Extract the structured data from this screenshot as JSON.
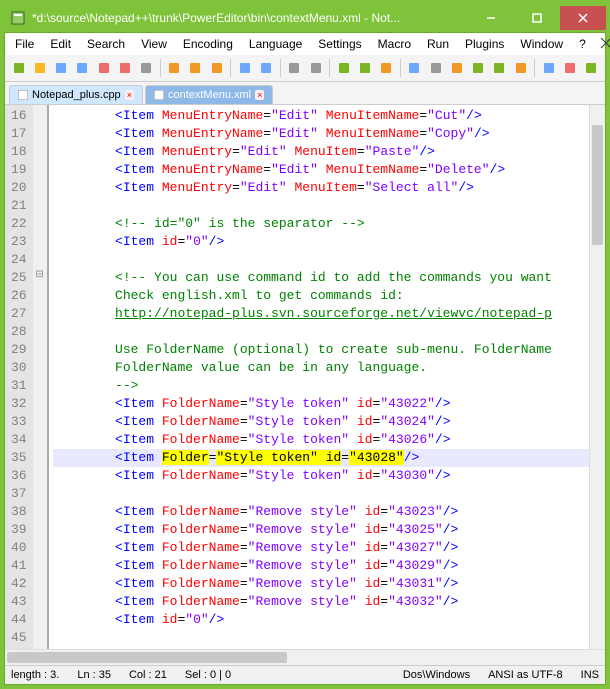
{
  "title": "*d:\\source\\Notepad++\\trunk\\PowerEditor\\bin\\contextMenu.xml - Not...",
  "menu": [
    "File",
    "Edit",
    "Search",
    "View",
    "Encoding",
    "Language",
    "Settings",
    "Macro",
    "Run",
    "Plugins",
    "Window",
    "?"
  ],
  "tabs": [
    {
      "label": "Notepad_plus.cpp",
      "active": false
    },
    {
      "label": "contextMenu.xml",
      "active": true
    }
  ],
  "lines": [
    {
      "n": 16,
      "tokens": [
        {
          "t": "<Item ",
          "c": "tag"
        },
        {
          "t": "MenuEntryName",
          "c": "attr"
        },
        {
          "t": "=",
          "c": "blk"
        },
        {
          "t": "\"Edit\"",
          "c": "str"
        },
        {
          "t": " MenuItemName",
          "c": "attr"
        },
        {
          "t": "=",
          "c": "blk"
        },
        {
          "t": "\"Cut\"",
          "c": "str"
        },
        {
          "t": "/>",
          "c": "tag"
        }
      ]
    },
    {
      "n": 17,
      "tokens": [
        {
          "t": "<Item ",
          "c": "tag"
        },
        {
          "t": "MenuEntryName",
          "c": "attr"
        },
        {
          "t": "=",
          "c": "blk"
        },
        {
          "t": "\"Edit\"",
          "c": "str"
        },
        {
          "t": " MenuItemName",
          "c": "attr"
        },
        {
          "t": "=",
          "c": "blk"
        },
        {
          "t": "\"Copy\"",
          "c": "str"
        },
        {
          "t": "/>",
          "c": "tag"
        }
      ]
    },
    {
      "n": 18,
      "tokens": [
        {
          "t": "<Item ",
          "c": "tag"
        },
        {
          "t": "MenuEntry",
          "c": "attr"
        },
        {
          "t": "=",
          "c": "blk"
        },
        {
          "t": "\"Edit\"",
          "c": "str"
        },
        {
          "t": " MenuItem",
          "c": "attr"
        },
        {
          "t": "=",
          "c": "blk"
        },
        {
          "t": "\"Paste\"",
          "c": "str"
        },
        {
          "t": "/>",
          "c": "tag"
        }
      ]
    },
    {
      "n": 19,
      "tokens": [
        {
          "t": "<Item ",
          "c": "tag"
        },
        {
          "t": "MenuEntryName",
          "c": "attr"
        },
        {
          "t": "=",
          "c": "blk"
        },
        {
          "t": "\"Edit\"",
          "c": "str"
        },
        {
          "t": " MenuItemName",
          "c": "attr"
        },
        {
          "t": "=",
          "c": "blk"
        },
        {
          "t": "\"Delete\"",
          "c": "str"
        },
        {
          "t": "/>",
          "c": "tag"
        }
      ]
    },
    {
      "n": 20,
      "tokens": [
        {
          "t": "<Item ",
          "c": "tag"
        },
        {
          "t": "MenuEntry",
          "c": "attr"
        },
        {
          "t": "=",
          "c": "blk"
        },
        {
          "t": "\"Edit\"",
          "c": "str"
        },
        {
          "t": " MenuItem",
          "c": "attr"
        },
        {
          "t": "=",
          "c": "blk"
        },
        {
          "t": "\"Select all\"",
          "c": "str"
        },
        {
          "t": "/>",
          "c": "tag"
        }
      ]
    },
    {
      "n": 21,
      "tokens": []
    },
    {
      "n": 22,
      "tokens": [
        {
          "t": "<!-- id=\"0\" is the separator -->",
          "c": "cmt"
        }
      ]
    },
    {
      "n": 23,
      "tokens": [
        {
          "t": "<Item ",
          "c": "tag"
        },
        {
          "t": "id",
          "c": "attr"
        },
        {
          "t": "=",
          "c": "blk"
        },
        {
          "t": "\"0\"",
          "c": "str"
        },
        {
          "t": "/>",
          "c": "tag"
        }
      ]
    },
    {
      "n": 24,
      "tokens": []
    },
    {
      "n": 25,
      "tokens": [
        {
          "t": "<!-- You can use command id to add the commands you want",
          "c": "cmt"
        }
      ],
      "fold": "-"
    },
    {
      "n": 26,
      "tokens": [
        {
          "t": "Check english.xml to get commands id:",
          "c": "cmt"
        }
      ]
    },
    {
      "n": 27,
      "tokens": [
        {
          "t": "http://notepad-plus.svn.sourceforge.net/viewvc/notepad-p",
          "c": "cmt underline"
        }
      ]
    },
    {
      "n": 28,
      "tokens": []
    },
    {
      "n": 29,
      "tokens": [
        {
          "t": "Use FolderName (optional) to create sub-menu. FolderName",
          "c": "cmt"
        }
      ]
    },
    {
      "n": 30,
      "tokens": [
        {
          "t": "FolderName value can be in any language.",
          "c": "cmt"
        }
      ]
    },
    {
      "n": 31,
      "tokens": [
        {
          "t": "-->",
          "c": "cmt"
        }
      ]
    },
    {
      "n": 32,
      "tokens": [
        {
          "t": "<Item ",
          "c": "tag"
        },
        {
          "t": "FolderName",
          "c": "attr"
        },
        {
          "t": "=",
          "c": "blk"
        },
        {
          "t": "\"Style token\"",
          "c": "str"
        },
        {
          "t": " id",
          "c": "attr"
        },
        {
          "t": "=",
          "c": "blk"
        },
        {
          "t": "\"43022\"",
          "c": "str"
        },
        {
          "t": "/>",
          "c": "tag"
        }
      ]
    },
    {
      "n": 33,
      "tokens": [
        {
          "t": "<Item ",
          "c": "tag"
        },
        {
          "t": "FolderName",
          "c": "attr"
        },
        {
          "t": "=",
          "c": "blk"
        },
        {
          "t": "\"Style token\"",
          "c": "str"
        },
        {
          "t": " id",
          "c": "attr"
        },
        {
          "t": "=",
          "c": "blk"
        },
        {
          "t": "\"43024\"",
          "c": "str"
        },
        {
          "t": "/>",
          "c": "tag"
        }
      ]
    },
    {
      "n": 34,
      "tokens": [
        {
          "t": "<Item ",
          "c": "tag"
        },
        {
          "t": "FolderName",
          "c": "attr"
        },
        {
          "t": "=",
          "c": "blk"
        },
        {
          "t": "\"Style token\"",
          "c": "str"
        },
        {
          "t": " id",
          "c": "attr"
        },
        {
          "t": "=",
          "c": "blk"
        },
        {
          "t": "\"43026\"",
          "c": "str"
        },
        {
          "t": "/>",
          "c": "tag"
        }
      ]
    },
    {
      "n": 35,
      "hl": true,
      "tokens": [
        {
          "t": "<Item ",
          "c": "tag"
        },
        {
          "t": "Folder",
          "c": "hly"
        },
        {
          "t": "=",
          "c": "blk"
        },
        {
          "t": "\"Style token\" ",
          "c": "hly"
        },
        {
          "t": "id",
          "c": "hly"
        },
        {
          "t": "=",
          "c": "blk"
        },
        {
          "t": "\"43028\"",
          "c": "hly"
        },
        {
          "t": "/>",
          "c": "tag"
        }
      ]
    },
    {
      "n": 36,
      "tokens": [
        {
          "t": "<Item ",
          "c": "tag"
        },
        {
          "t": "FolderName",
          "c": "attr"
        },
        {
          "t": "=",
          "c": "blk"
        },
        {
          "t": "\"Style token\"",
          "c": "str"
        },
        {
          "t": " id",
          "c": "attr"
        },
        {
          "t": "=",
          "c": "blk"
        },
        {
          "t": "\"43030\"",
          "c": "str"
        },
        {
          "t": "/>",
          "c": "tag"
        }
      ]
    },
    {
      "n": 37,
      "tokens": []
    },
    {
      "n": 38,
      "tokens": [
        {
          "t": "<Item ",
          "c": "tag"
        },
        {
          "t": "FolderName",
          "c": "attr"
        },
        {
          "t": "=",
          "c": "blk"
        },
        {
          "t": "\"Remove style\"",
          "c": "str"
        },
        {
          "t": " id",
          "c": "attr"
        },
        {
          "t": "=",
          "c": "blk"
        },
        {
          "t": "\"43023\"",
          "c": "str"
        },
        {
          "t": "/>",
          "c": "tag"
        }
      ]
    },
    {
      "n": 39,
      "tokens": [
        {
          "t": "<Item ",
          "c": "tag"
        },
        {
          "t": "FolderName",
          "c": "attr"
        },
        {
          "t": "=",
          "c": "blk"
        },
        {
          "t": "\"Remove style\"",
          "c": "str"
        },
        {
          "t": " id",
          "c": "attr"
        },
        {
          "t": "=",
          "c": "blk"
        },
        {
          "t": "\"43025\"",
          "c": "str"
        },
        {
          "t": "/>",
          "c": "tag"
        }
      ]
    },
    {
      "n": 40,
      "tokens": [
        {
          "t": "<Item ",
          "c": "tag"
        },
        {
          "t": "FolderName",
          "c": "attr"
        },
        {
          "t": "=",
          "c": "blk"
        },
        {
          "t": "\"Remove style\"",
          "c": "str"
        },
        {
          "t": " id",
          "c": "attr"
        },
        {
          "t": "=",
          "c": "blk"
        },
        {
          "t": "\"43027\"",
          "c": "str"
        },
        {
          "t": "/>",
          "c": "tag"
        }
      ]
    },
    {
      "n": 41,
      "tokens": [
        {
          "t": "<Item ",
          "c": "tag"
        },
        {
          "t": "FolderName",
          "c": "attr"
        },
        {
          "t": "=",
          "c": "blk"
        },
        {
          "t": "\"Remove style\"",
          "c": "str"
        },
        {
          "t": " id",
          "c": "attr"
        },
        {
          "t": "=",
          "c": "blk"
        },
        {
          "t": "\"43029\"",
          "c": "str"
        },
        {
          "t": "/>",
          "c": "tag"
        }
      ]
    },
    {
      "n": 42,
      "tokens": [
        {
          "t": "<Item ",
          "c": "tag"
        },
        {
          "t": "FolderName",
          "c": "attr"
        },
        {
          "t": "=",
          "c": "blk"
        },
        {
          "t": "\"Remove style\"",
          "c": "str"
        },
        {
          "t": " id",
          "c": "attr"
        },
        {
          "t": "=",
          "c": "blk"
        },
        {
          "t": "\"43031\"",
          "c": "str"
        },
        {
          "t": "/>",
          "c": "tag"
        }
      ]
    },
    {
      "n": 43,
      "tokens": [
        {
          "t": "<Item ",
          "c": "tag"
        },
        {
          "t": "FolderName",
          "c": "attr"
        },
        {
          "t": "=",
          "c": "blk"
        },
        {
          "t": "\"Remove style\"",
          "c": "str"
        },
        {
          "t": " id",
          "c": "attr"
        },
        {
          "t": "=",
          "c": "blk"
        },
        {
          "t": "\"43032\"",
          "c": "str"
        },
        {
          "t": "/>",
          "c": "tag"
        }
      ]
    },
    {
      "n": 44,
      "tokens": [
        {
          "t": "<Item ",
          "c": "tag"
        },
        {
          "t": "id",
          "c": "attr"
        },
        {
          "t": "=",
          "c": "blk"
        },
        {
          "t": "\"0\"",
          "c": "str"
        },
        {
          "t": "/>",
          "c": "tag"
        }
      ]
    },
    {
      "n": 45,
      "tokens": []
    }
  ],
  "status": {
    "length": "length : 3.",
    "ln": "Ln : 35",
    "col": "Col : 21",
    "sel": "Sel : 0 | 0",
    "eol": "Dos\\Windows",
    "enc": "ANSI as UTF-8",
    "mode": "INS"
  },
  "toolbar_icons": [
    "new",
    "open",
    "save",
    "save-all",
    "close",
    "close-all",
    "print",
    "cut",
    "copy",
    "paste",
    "undo",
    "redo",
    "find",
    "replace",
    "zoom-in",
    "zoom-out",
    "sync",
    "wrap",
    "chars",
    "indent",
    "fold",
    "unfold",
    "doc-map",
    "func-list",
    "record",
    "play"
  ]
}
